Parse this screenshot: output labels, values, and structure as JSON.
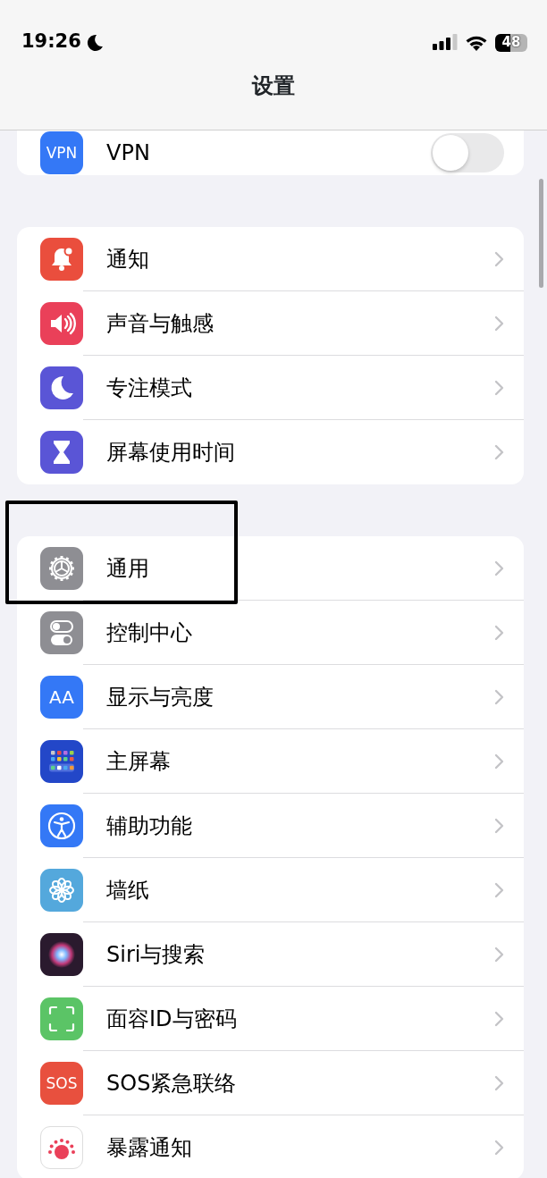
{
  "status_bar": {
    "time": "19:26",
    "focus_moon": true,
    "battery": "48"
  },
  "title": "设置",
  "groups": [
    {
      "items": [
        {
          "icon_text": "VPN",
          "color": "#3478f6",
          "label": "VPN",
          "kind": "toggle",
          "on": false
        }
      ]
    },
    {
      "items": [
        {
          "color": "#ea4e3d",
          "label": "通知",
          "kind": "link"
        },
        {
          "color": "#ea4059",
          "label": "声音与触感",
          "kind": "link"
        },
        {
          "color": "#5a55d6",
          "label": "专注模式",
          "kind": "link"
        },
        {
          "color": "#5a55d6",
          "label": "屏幕使用时间",
          "kind": "link"
        }
      ]
    },
    {
      "items": [
        {
          "color": "#8e8e93",
          "label": "通用",
          "kind": "link",
          "annotated": true
        },
        {
          "color": "#8e8e93",
          "label": "控制中心",
          "kind": "link"
        },
        {
          "icon_text": "AA",
          "color": "#3478f6",
          "label": "显示与亮度",
          "kind": "link"
        },
        {
          "color": "#2347c8",
          "label": "主屏幕",
          "kind": "link"
        },
        {
          "color": "#3478f6",
          "label": "辅助功能",
          "kind": "link"
        },
        {
          "color": "#54a8dc",
          "label": "墙纸",
          "kind": "link"
        },
        {
          "color": "#2a1a2e",
          "label": "Siri与搜索",
          "kind": "link"
        },
        {
          "color": "#5bc466",
          "label": "面容ID与密码",
          "kind": "link"
        },
        {
          "icon_text": "SOS",
          "color": "#e8503e",
          "label": "SOS紧急联络",
          "kind": "link"
        },
        {
          "color": "#ffffff",
          "label": "暴露通知",
          "kind": "link"
        }
      ]
    }
  ]
}
